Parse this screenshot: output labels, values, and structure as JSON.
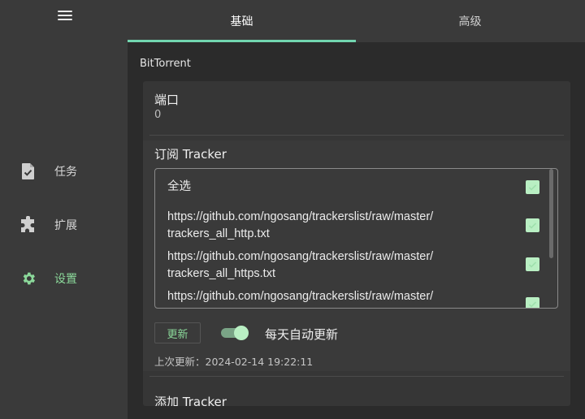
{
  "sidebar": {
    "items": [
      {
        "label": "任务",
        "icon": "task-file-check-icon"
      },
      {
        "label": "扩展",
        "icon": "puzzle-piece-icon"
      },
      {
        "label": "设置",
        "icon": "gear-icon"
      }
    ]
  },
  "tabs": [
    {
      "label": "基础",
      "active": true
    },
    {
      "label": "高级",
      "active": false
    }
  ],
  "section": {
    "title": "BitTorrent"
  },
  "port": {
    "label": "端口",
    "value": "0"
  },
  "tracker": {
    "title": "订阅 Tracker",
    "select_all": "全选",
    "items": [
      {
        "line1": "https://github.com/ngosang/trackerslist/raw/master/",
        "line2": "trackers_all_http.txt"
      },
      {
        "line1": "https://github.com/ngosang/trackerslist/raw/master/",
        "line2": "trackers_all_https.txt"
      },
      {
        "line1": "https://github.com/ngosang/trackerslist/raw/master/",
        "line2": ""
      }
    ],
    "update_button": "更新",
    "auto_update_label": "每天自动更新",
    "last_update": "上次更新：2024-02-14 19:22:11"
  },
  "add_tracker": {
    "label": "添加 Tracker"
  },
  "colors": {
    "accent": "#72d6b0",
    "active_text": "#8bd89a",
    "checkbox": "#b9efc3"
  }
}
